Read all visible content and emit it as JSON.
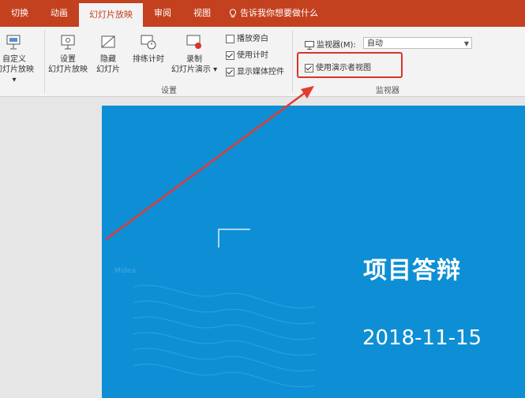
{
  "tabs": [
    {
      "label": "切换"
    },
    {
      "label": "动画"
    },
    {
      "label": "幻灯片放映"
    },
    {
      "label": "审阅"
    },
    {
      "label": "视图"
    }
  ],
  "tell_me": "告诉我你想要做什么",
  "ribbon": {
    "custom_slideshow": {
      "line1": "自定义",
      "line2": "幻灯片放映 ▾"
    },
    "setup_slideshow": {
      "line1": "设置",
      "line2": "幻灯片放映"
    },
    "hide_slide": {
      "line1": "隐藏",
      "line2": "幻灯片"
    },
    "rehearse": {
      "line1": "排练计时"
    },
    "record": {
      "line1": "录制",
      "line2": "幻灯片演示 ▾"
    },
    "checks": [
      {
        "label": "播放旁白",
        "checked": false
      },
      {
        "label": "使用计时",
        "checked": true
      },
      {
        "label": "显示媒体控件",
        "checked": true
      }
    ],
    "setup_group_label": "设置",
    "monitor_label": "监视器(M):",
    "monitor_value": "自动",
    "presenter_view": {
      "label": "使用演示者视图",
      "checked": true
    },
    "monitors_group_label": "监视器"
  },
  "slide": {
    "title": "项目答辩",
    "date": "2018-11-15",
    "watermark": "Midea"
  },
  "colors": {
    "tab_bar": "#c4411f",
    "slide_bg": "#0e8fd5",
    "annotation_red": "#d9342b"
  }
}
